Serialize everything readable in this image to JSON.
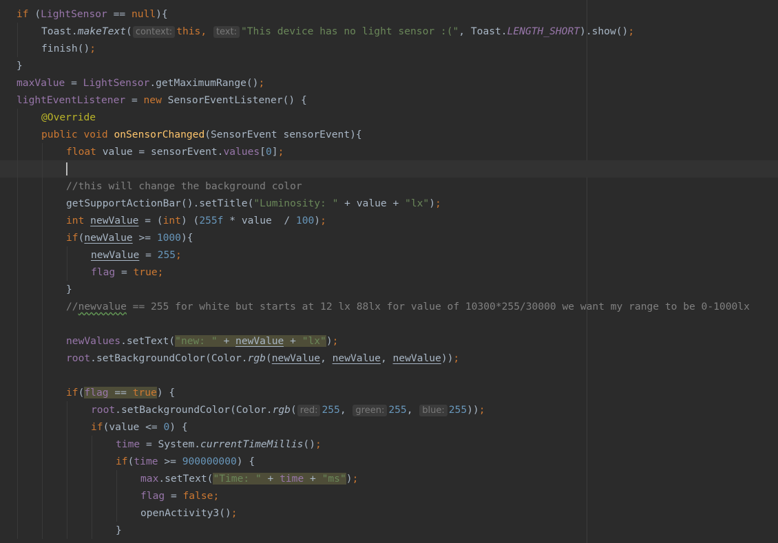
{
  "editor": {
    "current_line": 9,
    "lines": [
      {
        "indent": 0,
        "tokens": [
          {
            "t": "if",
            "c": "kw"
          },
          {
            "t": " ("
          },
          {
            "t": "LightSensor",
            "c": "fld"
          },
          {
            "t": " == "
          },
          {
            "t": "null",
            "c": "kw"
          },
          {
            "t": "){"
          }
        ]
      },
      {
        "indent": 1,
        "tokens": [
          {
            "t": "Toast."
          },
          {
            "t": "makeText",
            "c": "it"
          },
          {
            "t": "("
          },
          {
            "t": "context:",
            "c": "hint"
          },
          {
            "t": "this",
            "c": "kw"
          },
          {
            "t": ", ",
            "c": "kw"
          },
          {
            "t": "text:",
            "c": "hint"
          },
          {
            "t": "\"This device has no light sensor :(\"",
            "c": "str"
          },
          {
            "t": ", "
          },
          {
            "t": "Toast."
          },
          {
            "t": "LENGTH_SHORT",
            "c": "fld-i"
          },
          {
            "t": ").show()"
          },
          {
            "t": ";",
            "c": "kw"
          }
        ]
      },
      {
        "indent": 1,
        "tokens": [
          {
            "t": "finish()"
          },
          {
            "t": ";",
            "c": "kw"
          }
        ]
      },
      {
        "indent": 0,
        "tokens": [
          {
            "t": "}"
          }
        ]
      },
      {
        "indent": 0,
        "tokens": [
          {
            "t": "maxValue",
            "c": "fld"
          },
          {
            "t": " = "
          },
          {
            "t": "LightSensor",
            "c": "fld"
          },
          {
            "t": ".getMaximumRange()"
          },
          {
            "t": ";",
            "c": "kw"
          }
        ]
      },
      {
        "indent": 0,
        "tokens": [
          {
            "t": "lightEventListener",
            "c": "fld"
          },
          {
            "t": " = "
          },
          {
            "t": "new ",
            "c": "kw"
          },
          {
            "t": "SensorEventListener() {"
          }
        ]
      },
      {
        "indent": 1,
        "tokens": [
          {
            "t": "@Override",
            "c": "ann"
          }
        ]
      },
      {
        "indent": 1,
        "tokens": [
          {
            "t": "public void ",
            "c": "kw"
          },
          {
            "t": "onSensorChanged",
            "c": "fn"
          },
          {
            "t": "(SensorEvent sensorEvent){"
          }
        ]
      },
      {
        "indent": 2,
        "tokens": [
          {
            "t": "float ",
            "c": "kw"
          },
          {
            "t": "value = sensorEvent."
          },
          {
            "t": "values",
            "c": "fld"
          },
          {
            "t": "["
          },
          {
            "t": "0",
            "c": "num"
          },
          {
            "t": "]"
          },
          {
            "t": ";",
            "c": "kw"
          }
        ]
      },
      {
        "indent": 2,
        "tokens": [
          {
            "t": "",
            "c": "caret"
          }
        ]
      },
      {
        "indent": 2,
        "tokens": [
          {
            "t": "//this will change the background color",
            "c": "cmt"
          }
        ]
      },
      {
        "indent": 2,
        "tokens": [
          {
            "t": "getSupportActionBar().setTitle("
          },
          {
            "t": "\"Luminosity: \"",
            "c": "str"
          },
          {
            "t": " + value + "
          },
          {
            "t": "\"lx\"",
            "c": "str"
          },
          {
            "t": ")"
          },
          {
            "t": ";",
            "c": "kw"
          }
        ]
      },
      {
        "indent": 2,
        "tokens": [
          {
            "t": "int ",
            "c": "kw"
          },
          {
            "t": "newValue",
            "c": "ul"
          },
          {
            "t": " = ("
          },
          {
            "t": "int",
            "c": "kw"
          },
          {
            "t": ") ("
          },
          {
            "t": "255f",
            "c": "num"
          },
          {
            "t": " * value  / "
          },
          {
            "t": "100",
            "c": "num"
          },
          {
            "t": ")"
          },
          {
            "t": ";",
            "c": "kw"
          }
        ]
      },
      {
        "indent": 2,
        "tokens": [
          {
            "t": "if",
            "c": "kw"
          },
          {
            "t": "("
          },
          {
            "t": "newValue",
            "c": "ul"
          },
          {
            "t": " >= "
          },
          {
            "t": "1000",
            "c": "num"
          },
          {
            "t": "){"
          }
        ]
      },
      {
        "indent": 3,
        "tokens": [
          {
            "t": "newValue",
            "c": "ul"
          },
          {
            "t": " = "
          },
          {
            "t": "255",
            "c": "num"
          },
          {
            "t": ";",
            "c": "kw"
          }
        ]
      },
      {
        "indent": 3,
        "tokens": [
          {
            "t": "flag",
            "c": "fld"
          },
          {
            "t": " = "
          },
          {
            "t": "true",
            "c": "kw"
          },
          {
            "t": ";",
            "c": "kw"
          }
        ]
      },
      {
        "indent": 2,
        "tokens": [
          {
            "t": "}"
          }
        ]
      },
      {
        "indent": 2,
        "tokens": [
          {
            "t": "//",
            "c": "cmt"
          },
          {
            "t": "newvalue",
            "c": "cmt typo"
          },
          {
            "t": " == 255 for white but starts at 12 lx 88lx for value of 10300*255/30000 we want my range to be 0-1000lx",
            "c": "cmt"
          }
        ]
      },
      {
        "indent": 2,
        "tokens": []
      },
      {
        "indent": 2,
        "tokens": [
          {
            "t": "newValues",
            "c": "fld"
          },
          {
            "t": ".setText("
          },
          {
            "t": "\"new: \"",
            "c": "str hl"
          },
          {
            "t": " + ",
            "c": "hl"
          },
          {
            "t": "newValue",
            "c": "ul hl"
          },
          {
            "t": " + ",
            "c": "hl"
          },
          {
            "t": "\"lx\"",
            "c": "str hl"
          },
          {
            "t": ")"
          },
          {
            "t": ";",
            "c": "kw"
          }
        ]
      },
      {
        "indent": 2,
        "tokens": [
          {
            "t": "root",
            "c": "fld"
          },
          {
            "t": ".setBackgroundColor(Color."
          },
          {
            "t": "rgb",
            "c": "it"
          },
          {
            "t": "("
          },
          {
            "t": "newValue",
            "c": "ul"
          },
          {
            "t": ", "
          },
          {
            "t": "newValue",
            "c": "ul"
          },
          {
            "t": ", "
          },
          {
            "t": "newValue",
            "c": "ul"
          },
          {
            "t": "))"
          },
          {
            "t": ";",
            "c": "kw"
          }
        ]
      },
      {
        "indent": 2,
        "tokens": []
      },
      {
        "indent": 2,
        "tokens": [
          {
            "t": "if",
            "c": "kw"
          },
          {
            "t": "("
          },
          {
            "t": "flag",
            "c": "fld hl"
          },
          {
            "t": " == ",
            "c": "hl"
          },
          {
            "t": "true",
            "c": "kw hl"
          },
          {
            "t": ") {"
          }
        ]
      },
      {
        "indent": 3,
        "tokens": [
          {
            "t": "root",
            "c": "fld"
          },
          {
            "t": ".setBackgroundColor(Color."
          },
          {
            "t": "rgb",
            "c": "it"
          },
          {
            "t": "("
          },
          {
            "t": "red:",
            "c": "hint"
          },
          {
            "t": "255",
            "c": "num"
          },
          {
            "t": ", "
          },
          {
            "t": "green:",
            "c": "hint"
          },
          {
            "t": "255",
            "c": "num"
          },
          {
            "t": ", "
          },
          {
            "t": "blue:",
            "c": "hint"
          },
          {
            "t": "255",
            "c": "num"
          },
          {
            "t": "))"
          },
          {
            "t": ";",
            "c": "kw"
          }
        ]
      },
      {
        "indent": 3,
        "tokens": [
          {
            "t": "if",
            "c": "kw"
          },
          {
            "t": "(value <= "
          },
          {
            "t": "0",
            "c": "num"
          },
          {
            "t": ") {"
          }
        ]
      },
      {
        "indent": 4,
        "tokens": [
          {
            "t": "time",
            "c": "fld"
          },
          {
            "t": " = System."
          },
          {
            "t": "currentTimeMillis",
            "c": "it"
          },
          {
            "t": "()"
          },
          {
            "t": ";",
            "c": "kw"
          }
        ]
      },
      {
        "indent": 4,
        "tokens": [
          {
            "t": "if",
            "c": "kw"
          },
          {
            "t": "("
          },
          {
            "t": "time",
            "c": "fld"
          },
          {
            "t": " >= "
          },
          {
            "t": "900000000",
            "c": "num"
          },
          {
            "t": ") {"
          }
        ]
      },
      {
        "indent": 5,
        "tokens": [
          {
            "t": "max",
            "c": "fld"
          },
          {
            "t": ".setText("
          },
          {
            "t": "\"Time: \"",
            "c": "str hl"
          },
          {
            "t": " + ",
            "c": "hl"
          },
          {
            "t": "time",
            "c": "fld hl"
          },
          {
            "t": " + ",
            "c": "hl"
          },
          {
            "t": "\"ms\"",
            "c": "str hl"
          },
          {
            "t": ")"
          },
          {
            "t": ";",
            "c": "kw"
          }
        ]
      },
      {
        "indent": 5,
        "tokens": [
          {
            "t": "flag",
            "c": "fld"
          },
          {
            "t": " = "
          },
          {
            "t": "false",
            "c": "kw"
          },
          {
            "t": ";",
            "c": "kw"
          }
        ]
      },
      {
        "indent": 5,
        "tokens": [
          {
            "t": "openActivity3()"
          },
          {
            "t": ";",
            "c": "kw"
          }
        ]
      },
      {
        "indent": 4,
        "tokens": [
          {
            "t": "}"
          }
        ]
      }
    ]
  }
}
